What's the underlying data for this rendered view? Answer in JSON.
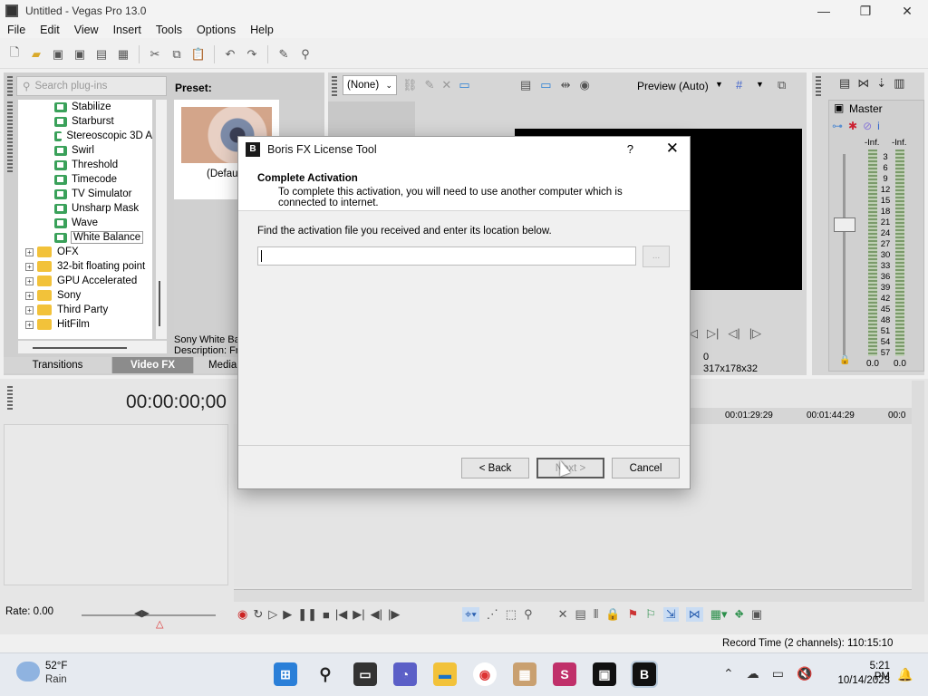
{
  "window": {
    "title": "Untitled - Vegas Pro 13.0",
    "minimize": "—",
    "maximize": "❐",
    "close": "✕"
  },
  "menu": [
    "File",
    "Edit",
    "View",
    "Insert",
    "Tools",
    "Options",
    "Help"
  ],
  "plugins": {
    "search_placeholder": "Search plug-ins",
    "preset_label": "Preset:",
    "preset_name": "(Defaul",
    "description_line1": "Sony White Ba",
    "description_line2": "Description: Fr",
    "fx_items": [
      "Stabilize",
      "Starburst",
      "Stereoscopic 3D A",
      "Swirl",
      "Threshold",
      "Timecode",
      "TV Simulator",
      "Unsharp Mask",
      "Wave",
      "White Balance"
    ],
    "selected_fx": "White Balance",
    "folders": [
      "OFX",
      "32-bit floating point",
      "GPU Accelerated",
      "Sony",
      "Third Party",
      "HitFilm"
    ],
    "tabs": [
      "Transitions",
      "Video FX",
      "Media Gene"
    ],
    "active_tab": "Video FX"
  },
  "preview": {
    "fx_select": "(None)",
    "mode": "Preview (Auto)",
    "frame": "0",
    "resolution": "317x178x32"
  },
  "master": {
    "label": "Master",
    "inf_left": "-Inf.",
    "inf_right": "-Inf.",
    "scale": [
      "3",
      "6",
      "9",
      "12",
      "15",
      "18",
      "21",
      "24",
      "27",
      "30",
      "33",
      "36",
      "39",
      "42",
      "45",
      "48",
      "51",
      "54",
      "57"
    ],
    "zero_left": "0.0",
    "zero_right": "0.0"
  },
  "timeline": {
    "timecode": "00:00:00;00",
    "ruler": [
      "00:01:29:29",
      "00:01:44:29",
      "00:0"
    ],
    "rate": "Rate: 0.00",
    "record_time": "Record Time (2 channels): 110:15:10"
  },
  "dialog": {
    "title": "Boris FX License Tool",
    "icon_letter": "B",
    "help": "?",
    "close": "✕",
    "heading": "Complete Activation",
    "subheading": "To complete this activation, you will need to use another computer which is connected to internet.",
    "instruction": "Find the activation file you received and enter its location below.",
    "file_value": "",
    "browse_label": "...",
    "back_label": "< Back",
    "next_label": "Next >",
    "cancel_label": "Cancel"
  },
  "taskbar": {
    "weather_temp": "52°F",
    "weather_desc": "Rain",
    "time": "5:21 PM",
    "date": "10/14/2023"
  }
}
